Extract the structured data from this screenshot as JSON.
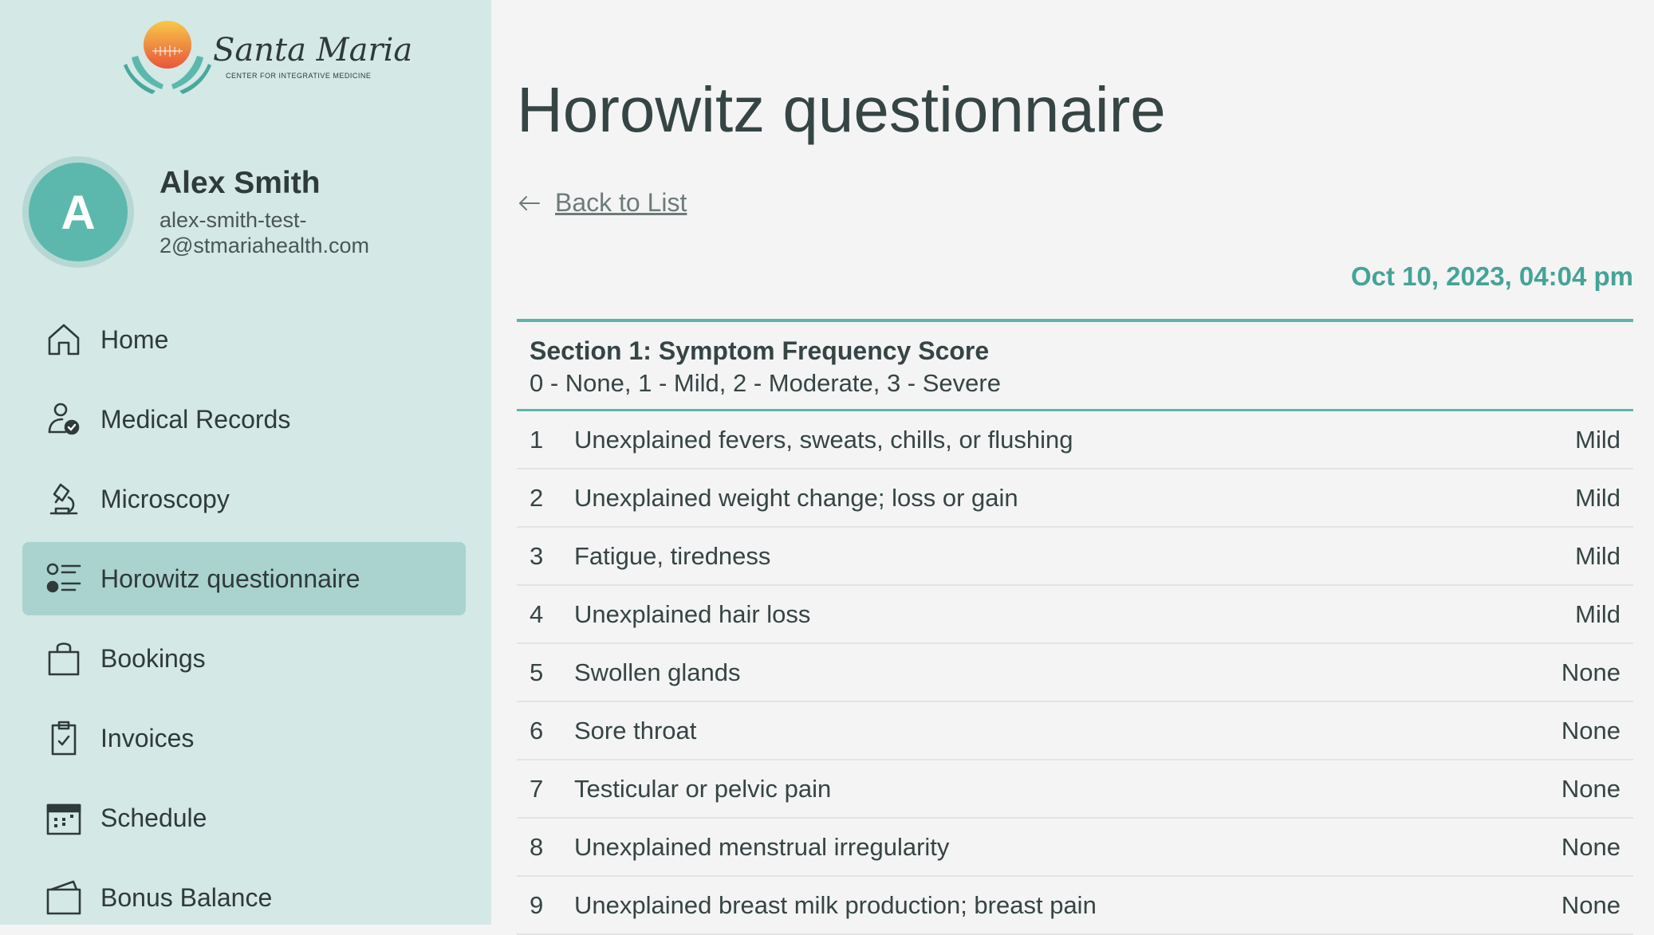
{
  "brand": {
    "name": "Santa Maria",
    "tagline": "CENTER FOR INTEGRATIVE MEDICINE"
  },
  "user": {
    "initial": "A",
    "name": "Alex Smith",
    "email": "alex-smith-test-2@stmariahealth.com"
  },
  "nav": {
    "items": [
      {
        "label": "Home",
        "icon": "home-icon"
      },
      {
        "label": "Medical Records",
        "icon": "user-check-icon"
      },
      {
        "label": "Microscopy",
        "icon": "microscope-icon"
      },
      {
        "label": "Horowitz questionnaire",
        "icon": "list-icon",
        "active": true
      },
      {
        "label": "Bookings",
        "icon": "shopping-bag-icon"
      },
      {
        "label": "Invoices",
        "icon": "clipboard-check-icon"
      },
      {
        "label": "Schedule",
        "icon": "calendar-icon"
      },
      {
        "label": "Bonus Balance",
        "icon": "wallet-icon"
      }
    ]
  },
  "main": {
    "title": "Horowitz questionnaire",
    "back_label": "Back to List",
    "date": "Oct 10, 2023, 04:04 pm",
    "section": {
      "title": "Section 1: Symptom Frequency Score",
      "scale": "0 - None, 1 - Mild, 2 - Moderate, 3 - Severe"
    },
    "rows": [
      {
        "num": "1",
        "question": "Unexplained fevers, sweats, chills, or flushing",
        "answer": "Mild"
      },
      {
        "num": "2",
        "question": "Unexplained weight change; loss or gain",
        "answer": "Mild"
      },
      {
        "num": "3",
        "question": "Fatigue, tiredness",
        "answer": "Mild"
      },
      {
        "num": "4",
        "question": "Unexplained hair loss",
        "answer": "Mild"
      },
      {
        "num": "5",
        "question": "Swollen glands",
        "answer": "None"
      },
      {
        "num": "6",
        "question": "Sore throat",
        "answer": "None"
      },
      {
        "num": "7",
        "question": "Testicular or pelvic pain",
        "answer": "None"
      },
      {
        "num": "8",
        "question": "Unexplained menstrual irregularity",
        "answer": "None"
      },
      {
        "num": "9",
        "question": "Unexplained breast milk production; breast pain",
        "answer": "None"
      }
    ]
  },
  "colors": {
    "sidebar_bg": "#d4e8e6",
    "active_bg": "#aad3cf",
    "accent": "#45a397",
    "avatar": "#5cb8ad"
  }
}
